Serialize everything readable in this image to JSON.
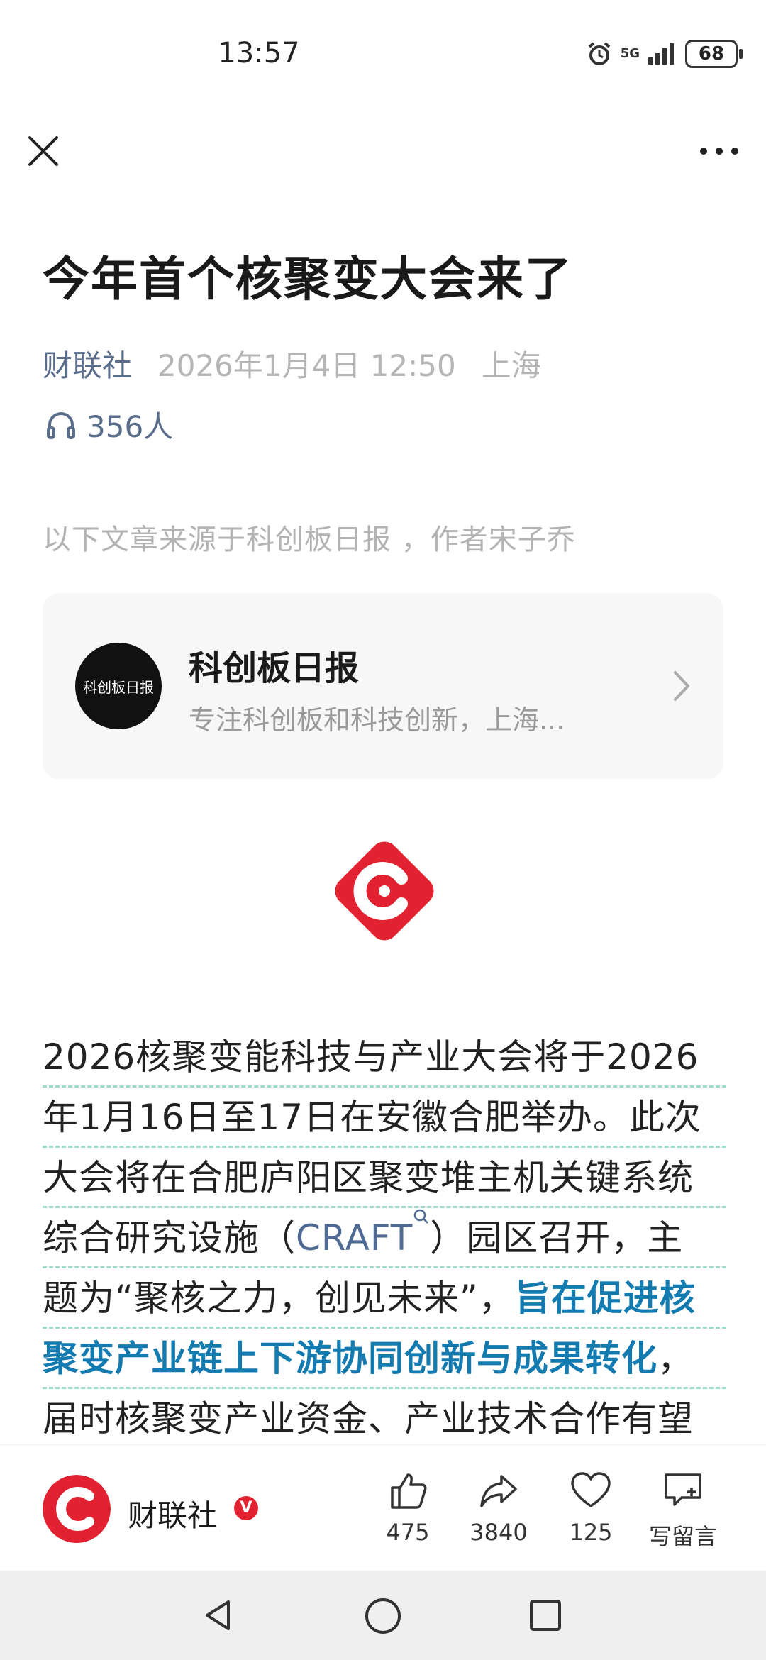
{
  "status": {
    "time": "13:57",
    "network": "5G",
    "battery": "68"
  },
  "article": {
    "title": "今年首个核聚变大会来了",
    "source": "财联社",
    "date": "2026年1月4日 12:50",
    "location": "上海",
    "listeners": "356人",
    "origin_note": "以下文章来源于科创板日报 ，作者宋子乔",
    "lines": {
      "l1": "2026核聚变能科技与产业大会将于2026",
      "l2": "年1月16日至17日在安徽合肥举办。此次",
      "l3": "大会将在合肥庐阳区聚变堆主机关键系统",
      "l4a": "综合研究设施（",
      "l4kw": "CRAFT",
      "l4b": "）园区召开，主",
      "l5a": "题为“聚核之力，创见未来”，",
      "l5hl": "旨在促进核",
      "l6hl": "聚变产业链上下游协同创新与成果转化",
      "l6b": "，",
      "l7": "届时核聚变产业资金、产业技术合作有望"
    }
  },
  "card": {
    "name": "科创板日报",
    "description": "专注科创板和科技创新，上海...",
    "avatar_text": "科创板日报"
  },
  "bottom_bar": {
    "account": "财联社",
    "verified_badge": "V",
    "likes": "475",
    "shares": "3840",
    "favorites": "125",
    "comment_label": "写留言"
  },
  "colors": {
    "brand_red": "#e32231",
    "link_blue": "#137bb0",
    "meta_blue": "#5a6e8c"
  }
}
